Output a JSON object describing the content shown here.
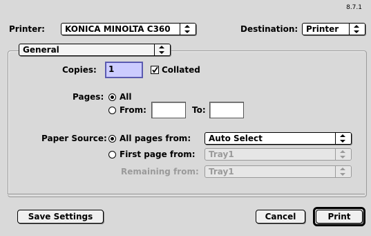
{
  "version": "8.7.1",
  "header": {
    "printer_label": "Printer:",
    "printer_value": "KONICA MINOLTA C360",
    "destination_label": "Destination:",
    "destination_value": "Printer"
  },
  "panel": {
    "selected": "General"
  },
  "copies": {
    "label": "Copies:",
    "value": "1",
    "collated_label": "Collated",
    "collated_checked": true
  },
  "pages": {
    "label": "Pages:",
    "all_label": "All",
    "from_label": "From:",
    "from_value": "",
    "to_label": "To:",
    "to_value": "",
    "selected": "All"
  },
  "paper_source": {
    "label": "Paper Source:",
    "all_pages_label": "All pages from:",
    "all_pages_value": "Auto Select",
    "first_page_label": "First page from:",
    "first_page_value": "Tray1",
    "remaining_label": "Remaining from:",
    "remaining_value": "Tray1",
    "selected": "All pages from:"
  },
  "buttons": {
    "save_settings": "Save Settings",
    "cancel": "Cancel",
    "print": "Print"
  }
}
